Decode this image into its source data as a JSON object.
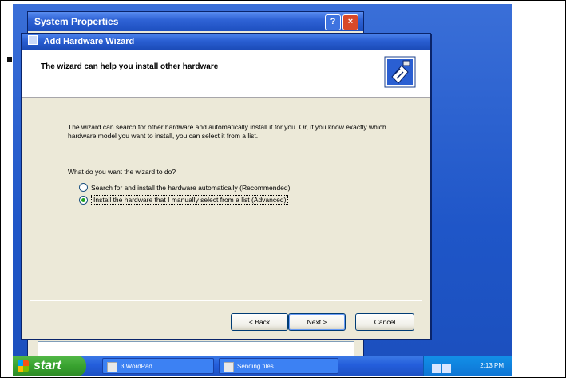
{
  "back_window": {
    "title": "System Properties",
    "help_button": "?",
    "close_button": "×"
  },
  "wizard": {
    "title": "Add Hardware Wizard",
    "header_text": "The wizard can help you install other hardware",
    "body_text": "The wizard can search for other hardware and automatically install it for you. Or, if you know exactly which hardware model you want to install, you can select it from a list.",
    "question": "What do you want the wizard to do?",
    "options": [
      {
        "label": "Search for and install the hardware automatically (Recommended)",
        "selected": false
      },
      {
        "label": "Install the hardware that I manually select from a list (Advanced)",
        "selected": true
      }
    ],
    "buttons": {
      "back": "< Back",
      "next": "Next >",
      "cancel": "Cancel"
    }
  },
  "taskbar": {
    "start_label": "start",
    "tasks": [
      {
        "label": "3 WordPad",
        "icon": "wordpad-icon"
      },
      {
        "label": "Sending files...",
        "icon": "send-files-icon"
      }
    ],
    "clock": "2:13 PM"
  }
}
